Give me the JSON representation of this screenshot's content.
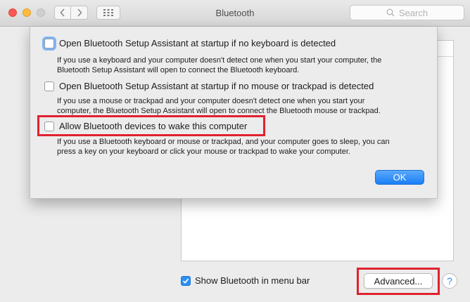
{
  "window": {
    "title": "Bluetooth",
    "search_placeholder": "Search"
  },
  "sheet": {
    "options": [
      {
        "label": "Open Bluetooth Setup Assistant at startup if no keyboard is detected",
        "checked": false,
        "focused": true,
        "description_lines": [
          "If you use a keyboard and your computer doesn't detect one when you start your computer, the",
          "Bluetooth Setup Assistant will open to connect the Bluetooth keyboard."
        ]
      },
      {
        "label": "Open Bluetooth Setup Assistant at startup if no mouse or trackpad is detected",
        "checked": false,
        "description_lines": [
          "If you use a mouse or trackpad and your computer doesn't detect one when you start your",
          "computer, the Bluetooth Setup Assistant will open to connect the Bluetooth mouse or trackpad."
        ]
      },
      {
        "label": "Allow Bluetooth devices to wake this computer",
        "checked": false,
        "highlighted": true,
        "description_lines": [
          "If you use a Bluetooth keyboard or mouse or trackpad, and your computer goes to sleep, you can",
          "press a key on your keyboard or click your mouse or trackpad to wake your computer."
        ]
      }
    ],
    "ok_label": "OK"
  },
  "footer": {
    "show_in_menu_bar_label": "Show Bluetooth in menu bar",
    "show_in_menu_bar_checked": true,
    "advanced_label": "Advanced...",
    "help_label": "?"
  },
  "colors": {
    "highlight": "#e0212f",
    "accent": "#2b8ff5"
  }
}
